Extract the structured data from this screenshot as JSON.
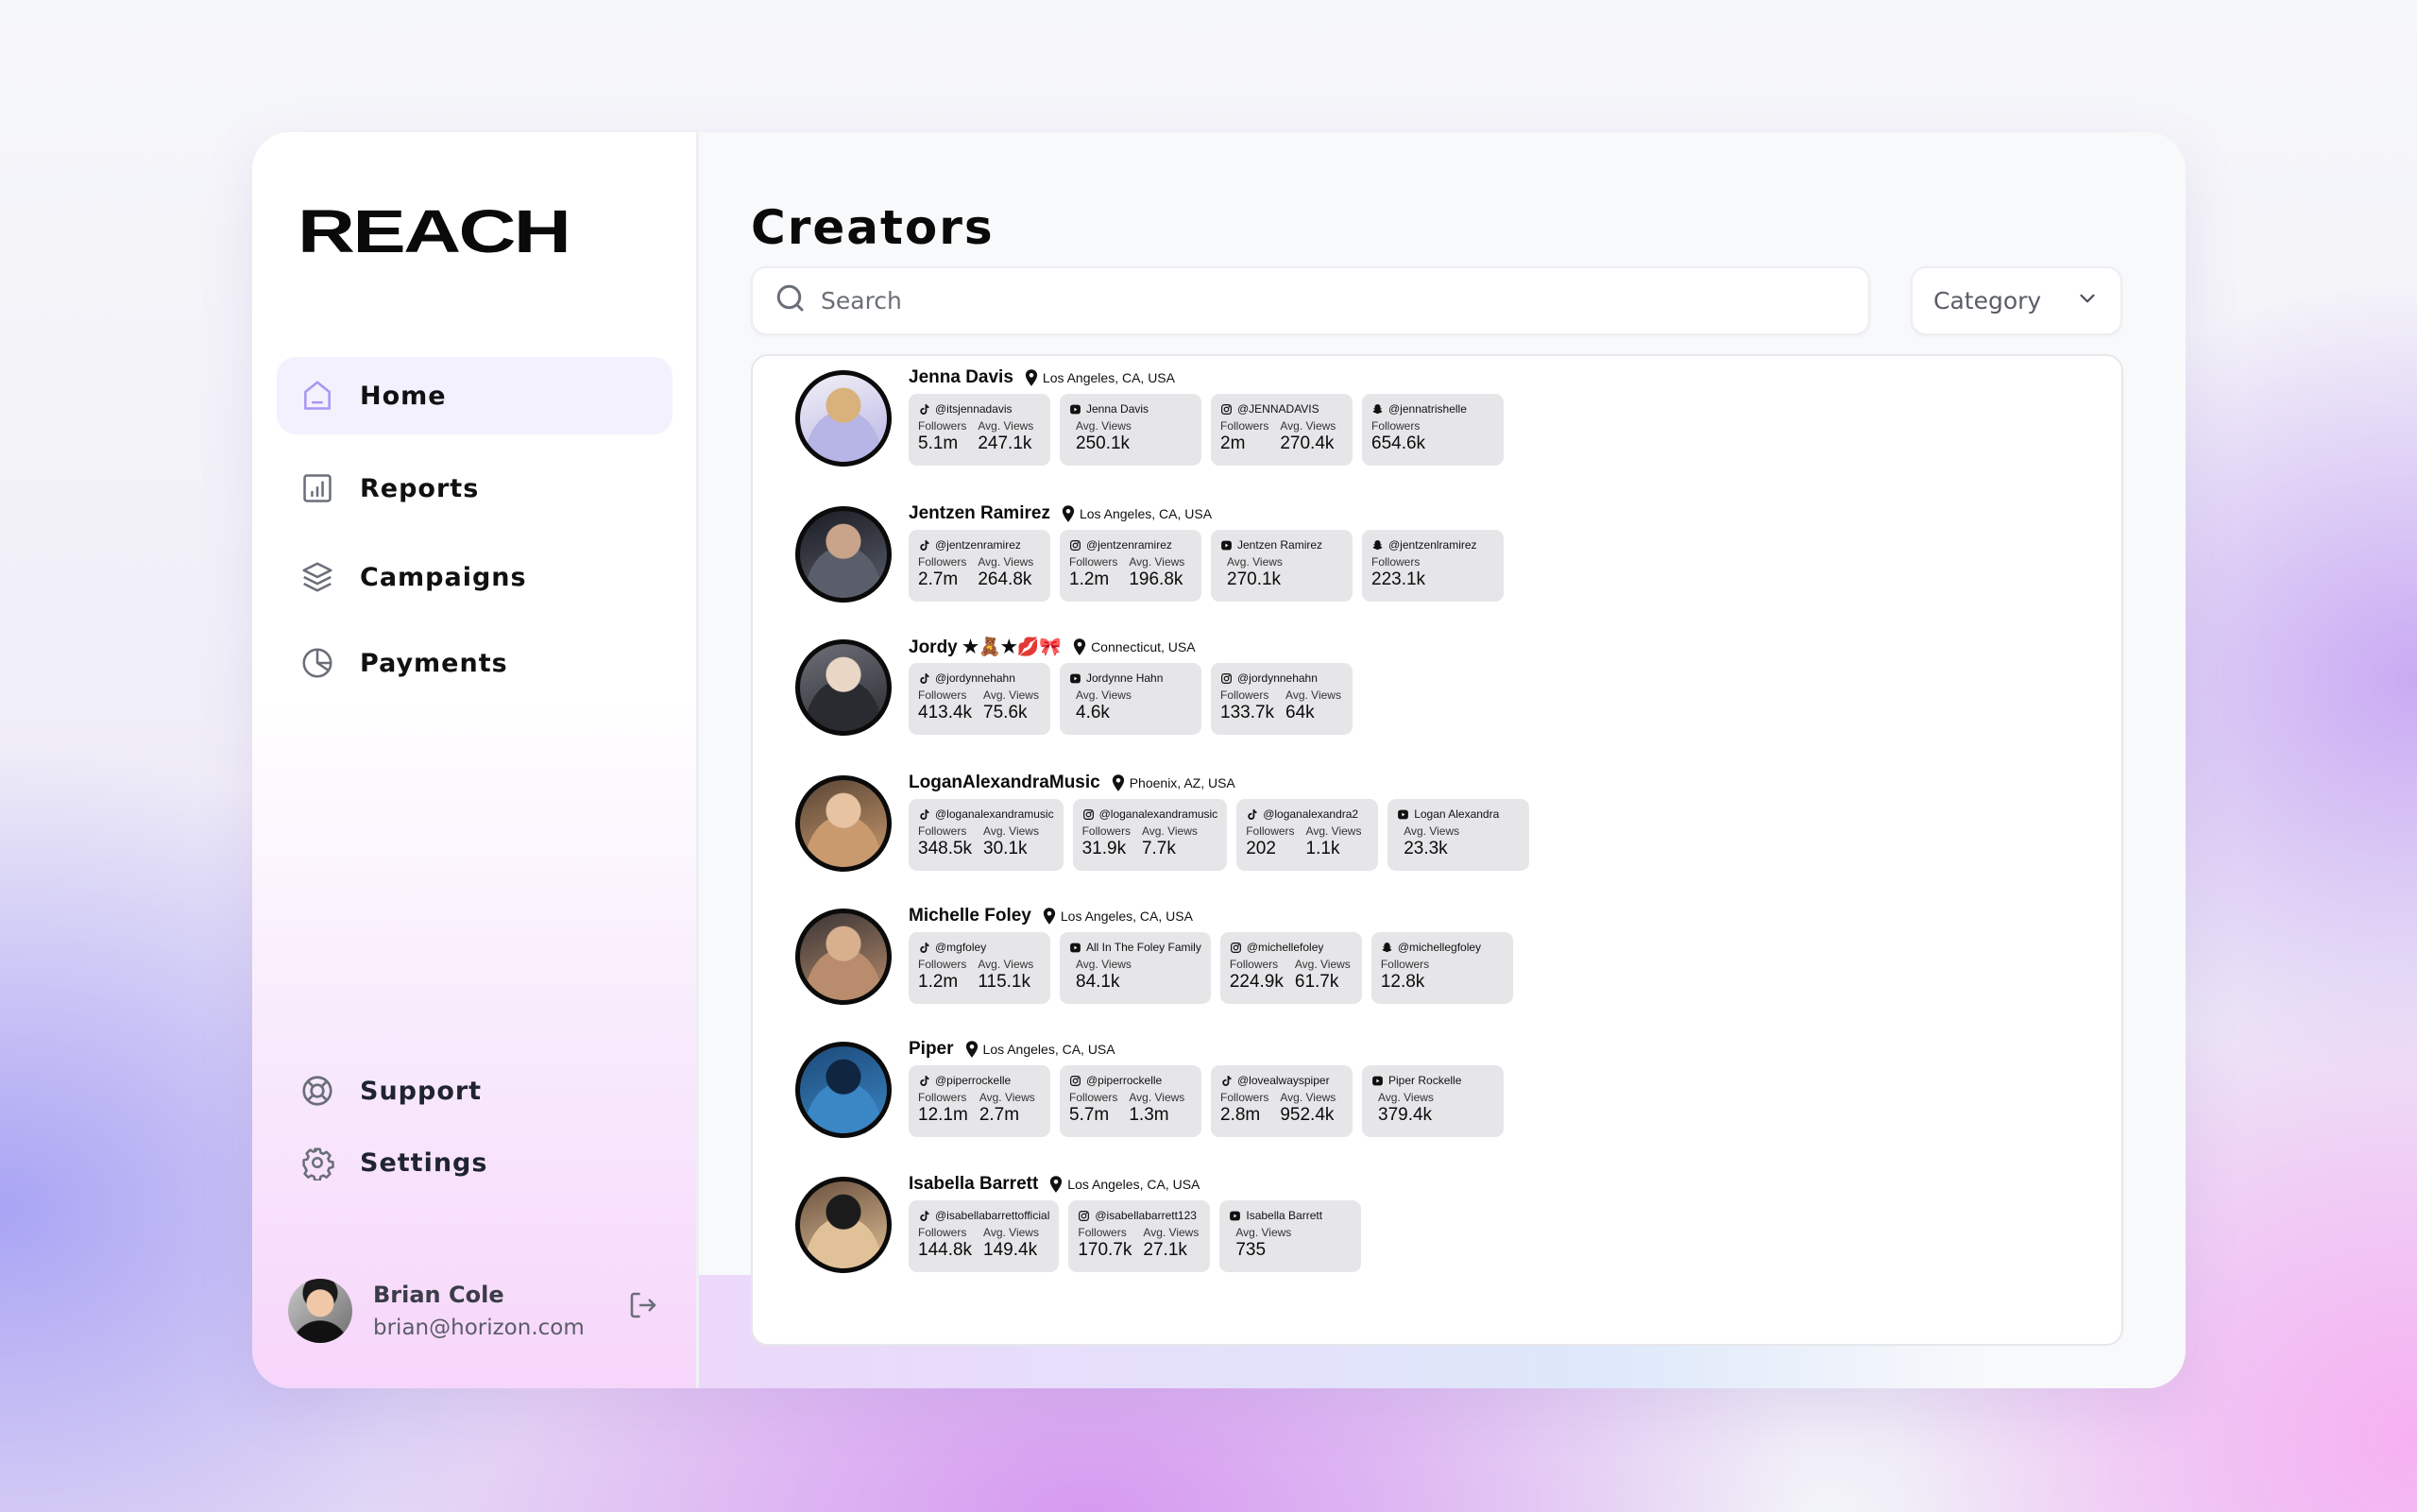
{
  "app": {
    "logo": "REACH"
  },
  "sidebar": {
    "nav": [
      {
        "label": "Home",
        "icon": "home-icon",
        "active": true
      },
      {
        "label": "Reports",
        "icon": "bar-chart-icon",
        "active": false
      },
      {
        "label": "Campaigns",
        "icon": "layers-icon",
        "active": false
      },
      {
        "label": "Payments",
        "icon": "pie-chart-icon",
        "active": false
      }
    ],
    "bottom_nav": [
      {
        "label": "Support",
        "icon": "lifebuoy-icon"
      },
      {
        "label": "Settings",
        "icon": "gear-icon"
      }
    ],
    "user": {
      "name": "Brian Cole",
      "email": "brian@horizon.com"
    }
  },
  "main": {
    "title": "Creators",
    "search": {
      "placeholder": "Search",
      "value": ""
    },
    "category": {
      "label": "Category"
    }
  },
  "colors": {
    "accent": "#9b8cf0",
    "active_bg": "#f3f1fe",
    "card_bg": "#e6e6e9"
  },
  "creators": [
    {
      "name": "Jenna Davis",
      "location": "Los Angeles, CA, USA",
      "avatar_tone": [
        "#f2f0f6",
        "#b7b4e6",
        "#d8b27a"
      ],
      "accounts": [
        {
          "platform": "tiktok",
          "handle": "@itsjennadavis",
          "followers": "5.1m",
          "avg_views": "247.1k"
        },
        {
          "platform": "youtube",
          "handle": "Jenna Davis",
          "avg_views": "250.1k"
        },
        {
          "platform": "instagram",
          "handle": "@JENNADAVIS",
          "followers": "2m",
          "avg_views": "270.4k"
        },
        {
          "platform": "snapchat",
          "handle": "@jennatrishelle",
          "followers": "654.6k"
        }
      ]
    },
    {
      "name": "Jentzen Ramirez",
      "location": "Los Angeles, CA, USA",
      "avatar_tone": [
        "#1b1d24",
        "#5a5e6a",
        "#c9a38a"
      ],
      "accounts": [
        {
          "platform": "tiktok",
          "handle": "@jentzenramirez",
          "followers": "2.7m",
          "avg_views": "264.8k"
        },
        {
          "platform": "instagram",
          "handle": "@jentzenramirez",
          "followers": "1.2m",
          "avg_views": "196.8k"
        },
        {
          "platform": "youtube",
          "handle": "Jentzen Ramirez",
          "avg_views": "270.1k"
        },
        {
          "platform": "snapchat",
          "handle": "@jentzenlramirez",
          "followers": "223.1k"
        }
      ]
    },
    {
      "name": "Jordy ★🧸★💋🎀",
      "location": "Connecticut, USA",
      "avatar_tone": [
        "#6d6f78",
        "#2a2b30",
        "#e9d6c4"
      ],
      "accounts": [
        {
          "platform": "tiktok",
          "handle": "@jordynnehahn",
          "followers": "413.4k",
          "avg_views": "75.6k"
        },
        {
          "platform": "youtube",
          "handle": "Jordynne Hahn",
          "avg_views": "4.6k"
        },
        {
          "platform": "instagram",
          "handle": "@jordynnehahn",
          "followers": "133.7k",
          "avg_views": "64k"
        }
      ]
    },
    {
      "name": "LoganAlexandraMusic",
      "location": "Phoenix, AZ, USA",
      "avatar_tone": [
        "#5b4636",
        "#c99a6e",
        "#e7c3a2"
      ],
      "accounts": [
        {
          "platform": "tiktok",
          "handle": "@loganalexandramusic",
          "followers": "348.5k",
          "avg_views": "30.1k"
        },
        {
          "platform": "instagram",
          "handle": "@loganalexandramusic",
          "followers": "31.9k",
          "avg_views": "7.7k"
        },
        {
          "platform": "tiktok",
          "handle": "@loganalexandra2",
          "followers": "202",
          "avg_views": "1.1k"
        },
        {
          "platform": "youtube",
          "handle": "Logan Alexandra",
          "avg_views": "23.3k"
        }
      ]
    },
    {
      "name": "Michelle Foley",
      "location": "Los Angeles, CA, USA",
      "avatar_tone": [
        "#3a3536",
        "#b88c6c",
        "#d9b08e"
      ],
      "accounts": [
        {
          "platform": "tiktok",
          "handle": "@mgfoley",
          "followers": "1.2m",
          "avg_views": "115.1k"
        },
        {
          "platform": "youtube",
          "handle": "All In The Foley Family",
          "avg_views": "84.1k"
        },
        {
          "platform": "instagram",
          "handle": "@michellefoley",
          "followers": "224.9k",
          "avg_views": "61.7k"
        },
        {
          "platform": "snapchat",
          "handle": "@michellegfoley",
          "followers": "12.8k"
        }
      ]
    },
    {
      "name": "Piper",
      "location": "Los Angeles, CA, USA",
      "avatar_tone": [
        "#1d4a7a",
        "#3b86c4",
        "#0f2540"
      ],
      "accounts": [
        {
          "platform": "tiktok",
          "handle": "@piperrockelle",
          "followers": "12.1m",
          "avg_views": "2.7m"
        },
        {
          "platform": "instagram",
          "handle": "@piperrockelle",
          "followers": "5.7m",
          "avg_views": "1.3m"
        },
        {
          "platform": "tiktok",
          "handle": "@lovealwayspiper",
          "followers": "2.8m",
          "avg_views": "952.4k"
        },
        {
          "platform": "youtube",
          "handle": "Piper Rockelle",
          "avg_views": "379.4k"
        }
      ]
    },
    {
      "name": "Isabella Barrett",
      "location": "Los Angeles, CA, USA",
      "avatar_tone": [
        "#6b5240",
        "#e1c197",
        "#1b1b1b"
      ],
      "accounts": [
        {
          "platform": "tiktok",
          "handle": "@isabellabarrettofficial",
          "followers": "144.8k",
          "avg_views": "149.4k"
        },
        {
          "platform": "instagram",
          "handle": "@isabellabarrett123",
          "followers": "170.7k",
          "avg_views": "27.1k"
        },
        {
          "platform": "youtube",
          "handle": "Isabella Barrett",
          "avg_views": "735"
        }
      ]
    }
  ],
  "labels": {
    "followers": "Followers",
    "avg_views": "Avg. Views"
  }
}
